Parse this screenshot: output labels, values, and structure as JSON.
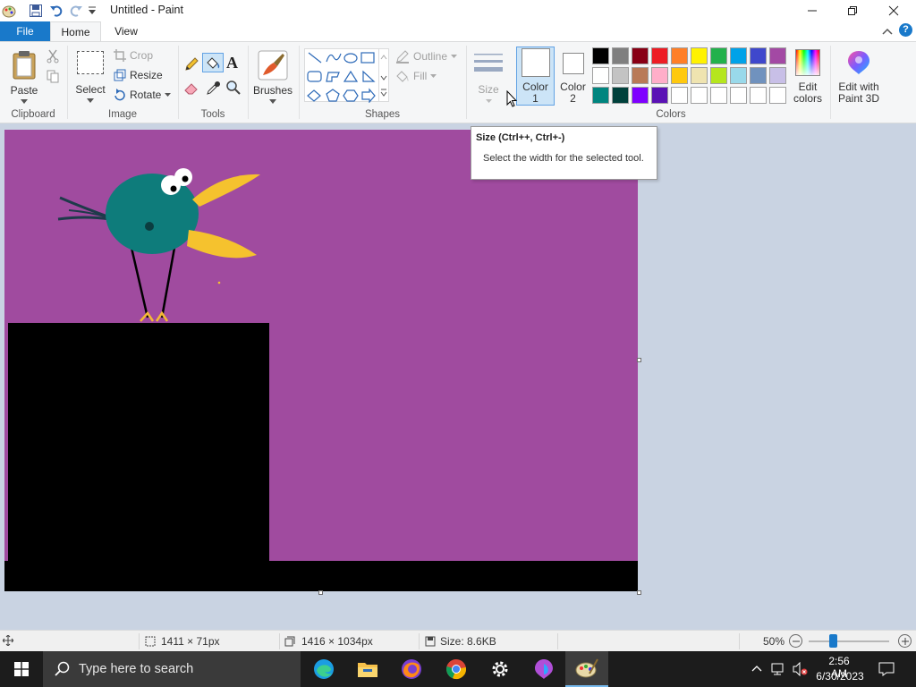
{
  "window": {
    "title": "Untitled - Paint"
  },
  "tabs": {
    "file": "File",
    "home": "Home",
    "view": "View"
  },
  "clipboard": {
    "paste_label": "Paste",
    "group_label": "Clipboard"
  },
  "image": {
    "select_label": "Select",
    "crop_label": "Crop",
    "resize_label": "Resize",
    "rotate_label": "Rotate",
    "group_label": "Image"
  },
  "tools": {
    "group_label": "Tools"
  },
  "brushes": {
    "label": "Brushes"
  },
  "shapes": {
    "outline_label": "Outline",
    "fill_label": "Fill",
    "group_label": "Shapes"
  },
  "size": {
    "label": "Size"
  },
  "colors": {
    "color1_line1": "Color",
    "color1_line2": "1",
    "color2_line1": "Color",
    "color2_line2": "2",
    "edit_line1": "Edit",
    "edit_line2": "colors",
    "group_label": "Colors",
    "paint3d_line1": "Edit with",
    "paint3d_line2": "Paint 3D",
    "palette_row1": [
      "#000000",
      "#7f7f7f",
      "#880015",
      "#ed1c24",
      "#ff7f27",
      "#fff200",
      "#22b14c",
      "#00a2e8",
      "#3f48cc",
      "#a349a4"
    ],
    "palette_row2": [
      "#ffffff",
      "#c3c3c3",
      "#b97a57",
      "#ffaec9",
      "#ffc90e",
      "#efe4b0",
      "#b5e61d",
      "#99d9ea",
      "#7092be",
      "#c8bfe7"
    ],
    "palette_row3": [
      "#00857f",
      "#00413c",
      "#7f00ff",
      "#5a12b5",
      "#ffffff",
      "#ffffff",
      "#ffffff",
      "#ffffff",
      "#ffffff",
      "#ffffff"
    ]
  },
  "tooltip": {
    "title": "Size (Ctrl++, Ctrl+-)",
    "description": "Select the width for the selected tool."
  },
  "canvas": {
    "background": "#a04b9f"
  },
  "status": {
    "selection_size": "1411 × 71px",
    "image_size": "1416 × 1034px",
    "file_size": "Size: 8.6KB",
    "zoom": "50%",
    "zoom_level": 0.5
  },
  "taskbar": {
    "search_placeholder": "Type here to search",
    "time": "2:56 AM",
    "date": "6/30/2023"
  }
}
